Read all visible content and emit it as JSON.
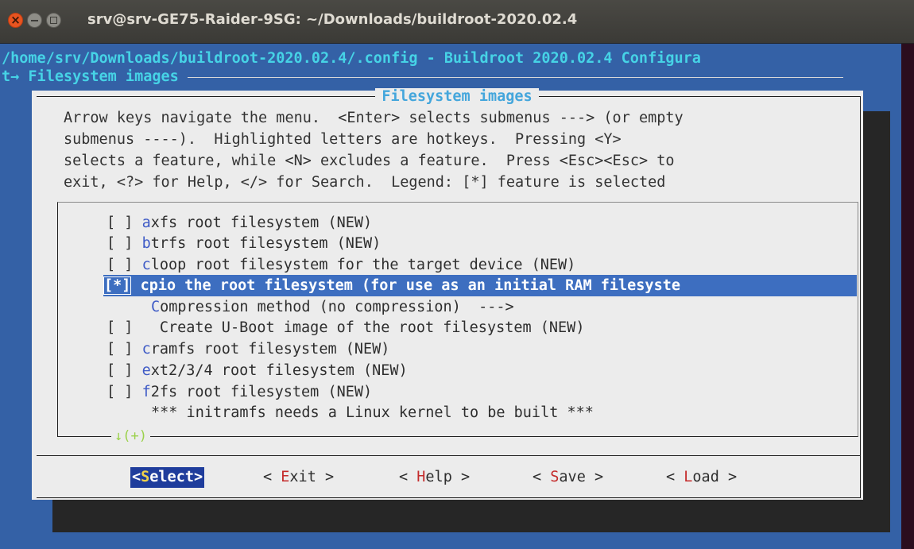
{
  "window": {
    "title": "srv@srv-GE75-Raider-9SG: ~/Downloads/buildroot-2020.02.4"
  },
  "header": {
    "path_line": "/home/srv/Downloads/buildroot-2020.02.4/.config - Buildroot 2020.02.4 Configura",
    "breadcrumb": "t→ Filesystem images "
  },
  "dialog": {
    "title": "Filesystem images",
    "help_text": "Arrow keys navigate the menu.  <Enter> selects submenus ---> (or empty\nsubmenus ----).  Highlighted letters are hotkeys.  Pressing <Y>\nselects a feature, while <N> excludes a feature.  Press <Esc><Esc> to\nexit, <?> for Help, </> for Search.  Legend: [*] feature is selected",
    "more_indicator": "↓(+)"
  },
  "menu": {
    "items": [
      {
        "check": "[ ]",
        "hotkey": "a",
        "rest": "xfs root filesystem (NEW)"
      },
      {
        "check": "[ ]",
        "hotkey": "b",
        "rest": "trfs root filesystem (NEW)"
      },
      {
        "check": "[ ]",
        "hotkey": "c",
        "rest": "loop root filesystem for the target device (NEW)"
      },
      {
        "check": "[*]",
        "hotkey": "c",
        "rest": "pio the root filesystem (for use as an initial RAM filesyste"
      },
      {
        "check": "",
        "hotkey": "C",
        "rest": "ompression method (no compression)  --->"
      },
      {
        "check": "[ ]",
        "hotkey": "",
        "rest": "   Create U-Boot image of the root filesystem (NEW)"
      },
      {
        "check": "[ ]",
        "hotkey": "c",
        "rest": "ramfs root filesystem (NEW)"
      },
      {
        "check": "[ ]",
        "hotkey": "e",
        "rest": "xt2/3/4 root filesystem (NEW)"
      },
      {
        "check": "[ ]",
        "hotkey": "f",
        "rest": "2fs root filesystem (NEW)"
      },
      {
        "check": "",
        "hotkey": "",
        "rest": "*** initramfs needs a Linux kernel to be built ***"
      }
    ]
  },
  "buttons": [
    {
      "pre": "<",
      "hotkey": "S",
      "post": "elect>"
    },
    {
      "pre": "< ",
      "hotkey": "E",
      "post": "xit >"
    },
    {
      "pre": "< ",
      "hotkey": "H",
      "post": "elp >"
    },
    {
      "pre": "< ",
      "hotkey": "S",
      "post": "ave >"
    },
    {
      "pre": "< ",
      "hotkey": "L",
      "post": "oad >"
    }
  ],
  "colors": {
    "terminal_bg": "#3461a6",
    "dialog_bg": "#ececec",
    "hotkey": "#3f5bc6",
    "selection": "#3d6ec0",
    "button_hotkey": "#c42b2b"
  }
}
